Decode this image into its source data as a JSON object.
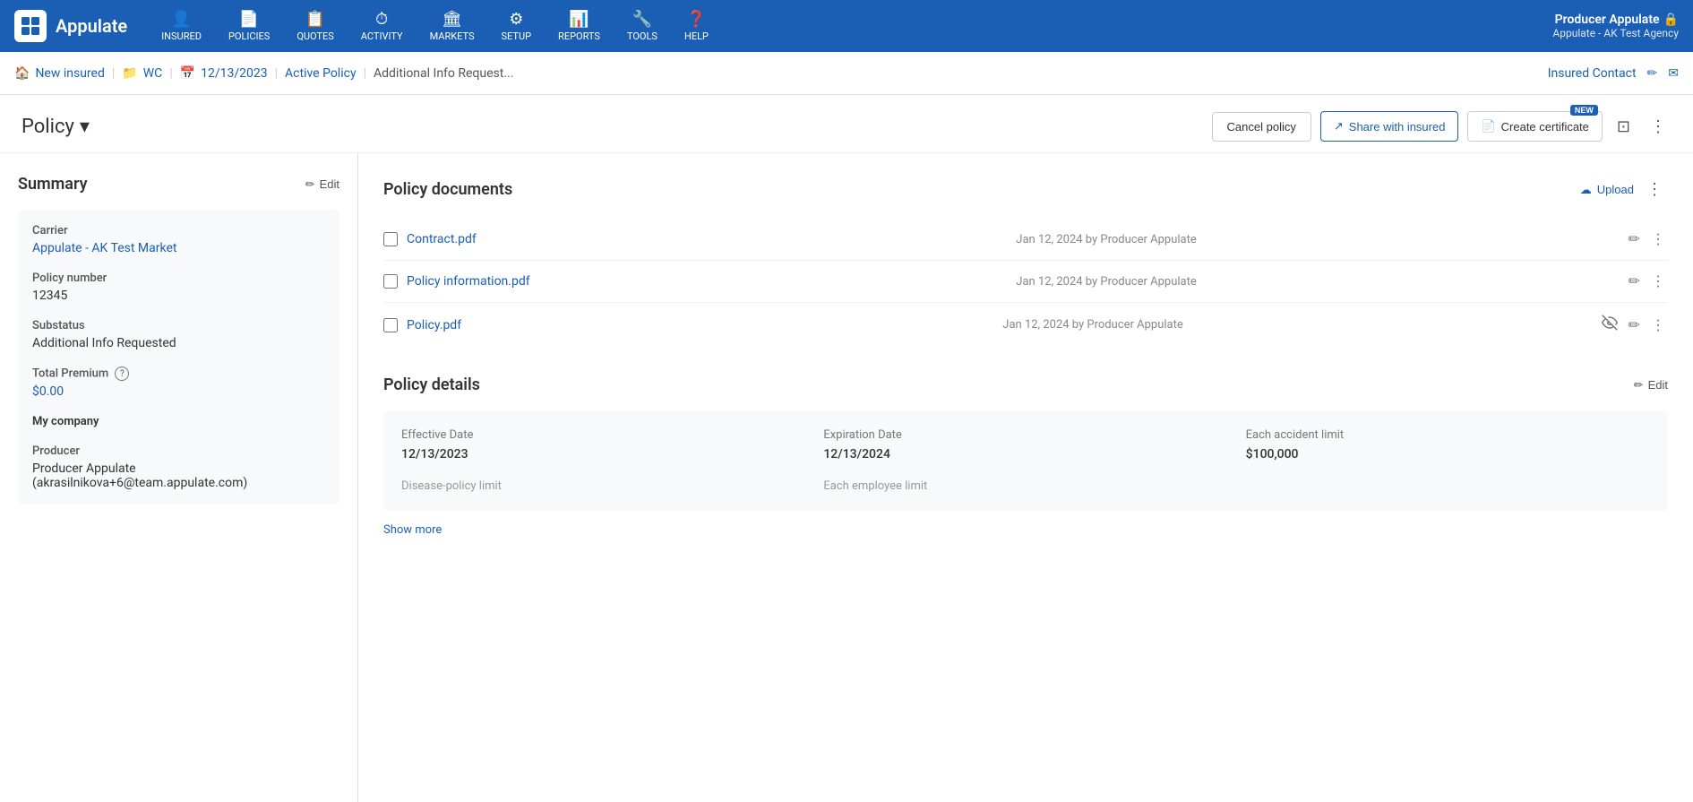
{
  "app": {
    "name": "Appulate"
  },
  "nav": {
    "items": [
      {
        "id": "insured",
        "icon": "👤",
        "label": "INSURED",
        "has_dropdown": true
      },
      {
        "id": "policies",
        "icon": "📄",
        "label": "POLICIES",
        "has_dropdown": true
      },
      {
        "id": "quotes",
        "icon": "📋",
        "label": "QUOTES",
        "has_dropdown": true
      },
      {
        "id": "activity",
        "icon": "⏱",
        "label": "ACTIVITY",
        "has_dropdown": false
      },
      {
        "id": "markets",
        "icon": "🏛",
        "label": "MARKETS",
        "has_dropdown": true
      },
      {
        "id": "setup",
        "icon": "⚙",
        "label": "SETUP",
        "has_dropdown": true
      },
      {
        "id": "reports",
        "icon": "📊",
        "label": "REPORTS",
        "has_dropdown": true
      },
      {
        "id": "tools",
        "icon": "🔧",
        "label": "TOOLS",
        "has_dropdown": true
      },
      {
        "id": "help",
        "icon": "❓",
        "label": "HELP",
        "has_dropdown": true
      }
    ],
    "user": {
      "name": "Producer Appulate",
      "lock_icon": "🔒",
      "agency": "Appulate - AK Test Agency"
    }
  },
  "breadcrumb": {
    "items": [
      {
        "id": "new-insured",
        "icon": "🏠",
        "label": "New insured"
      },
      {
        "id": "wc",
        "icon": "📁",
        "label": "WC"
      },
      {
        "id": "date",
        "icon": "📅",
        "label": "12/13/2023"
      },
      {
        "id": "active-policy",
        "label": "Active Policy"
      },
      {
        "id": "additional-info",
        "label": "Additional Info Request..."
      }
    ],
    "right": {
      "contact_label": "Insured Contact",
      "edit_icon": "✏",
      "mail_icon": "✉"
    }
  },
  "policy_header": {
    "title": "Policy",
    "dropdown_icon": "▾",
    "buttons": {
      "cancel": "Cancel policy",
      "share": "Share with insured",
      "certificate": "Create certificate",
      "new_badge": "NEW"
    }
  },
  "summary": {
    "title": "Summary",
    "edit_label": "Edit",
    "fields": {
      "carrier_label": "Carrier",
      "carrier_value": "Appulate - AK Test Market",
      "policy_number_label": "Policy number",
      "policy_number_value": "12345",
      "substatus_label": "Substatus",
      "substatus_value": "Additional Info Requested",
      "total_premium_label": "Total Premium",
      "total_premium_value": "$0.00",
      "my_company_label": "My company",
      "producer_label": "Producer",
      "producer_value": "Producer Appulate (akrasilnikova+6@team.appulate.com)"
    }
  },
  "policy_documents": {
    "title": "Policy documents",
    "upload_label": "Upload",
    "documents": [
      {
        "name": "Contract.pdf",
        "meta": "Jan 12, 2024 by Producer Appulate",
        "hidden": false
      },
      {
        "name": "Policy information.pdf",
        "meta": "Jan 12, 2024 by Producer Appulate",
        "hidden": false
      },
      {
        "name": "Policy.pdf",
        "meta": "Jan 12, 2024 by Producer Appulate",
        "hidden": true
      }
    ]
  },
  "policy_details": {
    "title": "Policy details",
    "edit_label": "Edit",
    "fields": [
      {
        "label": "Effective Date",
        "value": "12/13/2023",
        "empty": false
      },
      {
        "label": "Expiration Date",
        "value": "12/13/2024",
        "empty": false
      },
      {
        "label": "Each accident limit",
        "value": "$100,000",
        "empty": false
      },
      {
        "label": "Disease-policy limit",
        "value": "",
        "empty": true
      },
      {
        "label": "Each employee limit",
        "value": "",
        "empty": true
      }
    ],
    "show_more_label": "Show more"
  }
}
